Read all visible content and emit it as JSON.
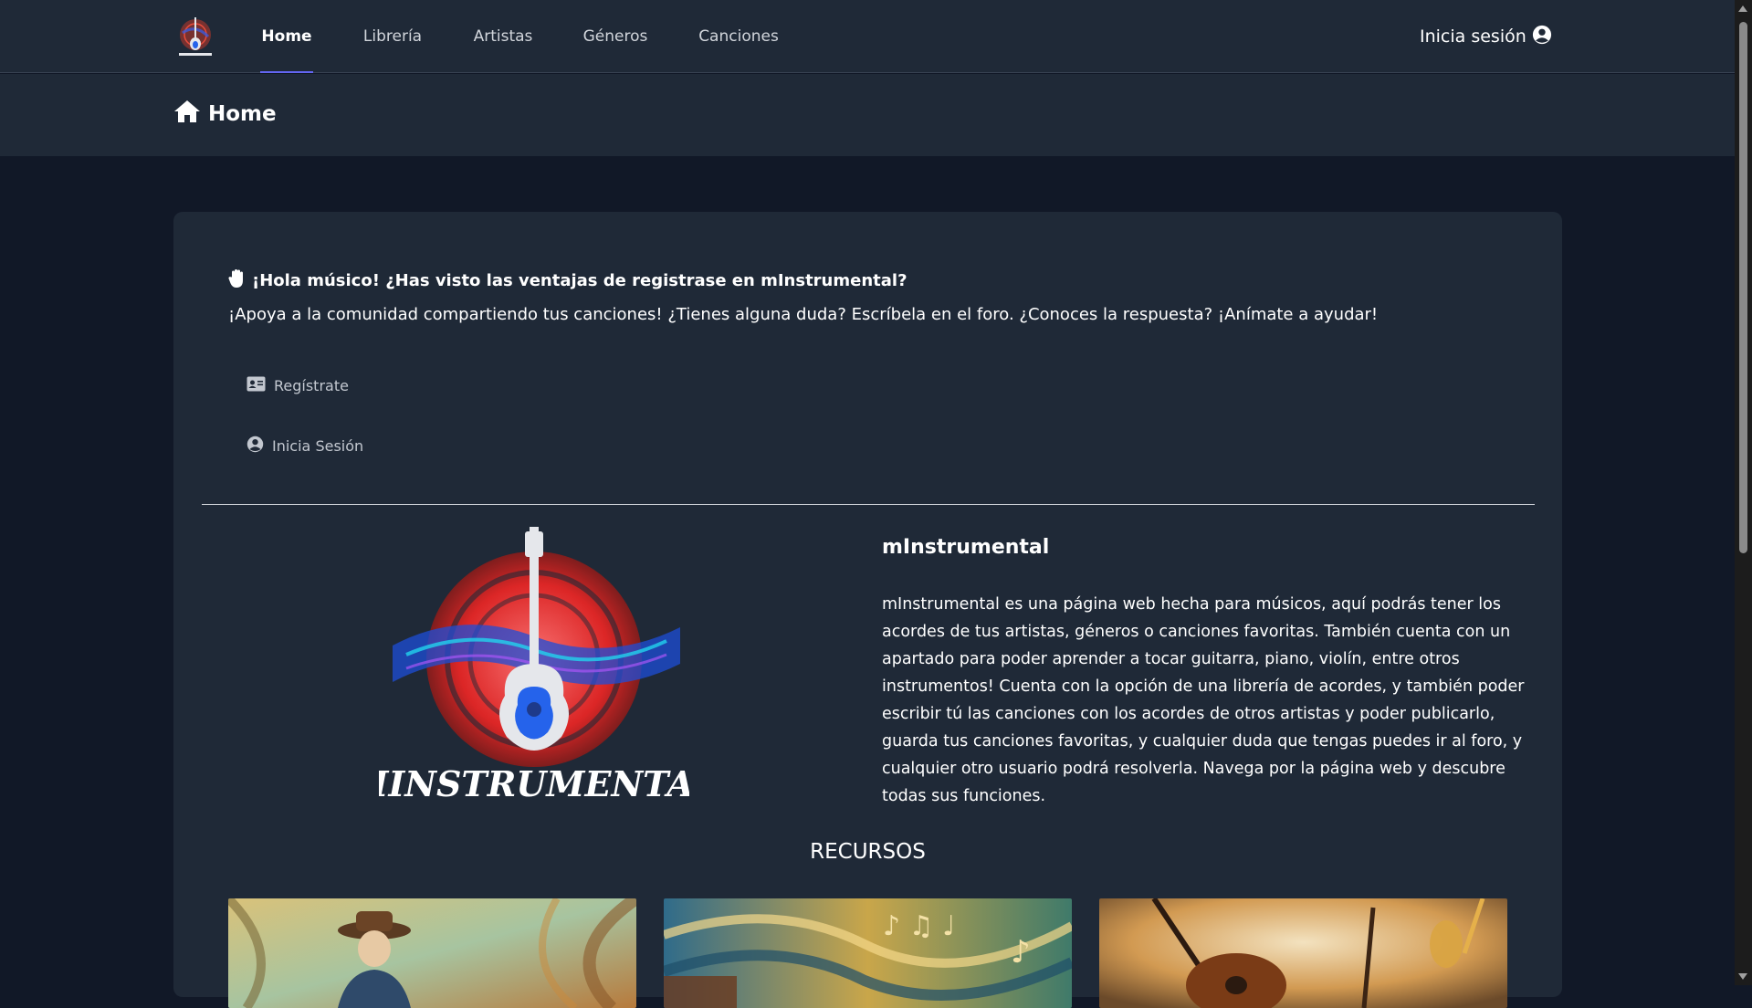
{
  "nav": {
    "links": [
      {
        "label": "Home",
        "active": true
      },
      {
        "label": "Librería",
        "active": false
      },
      {
        "label": "Artistas",
        "active": false
      },
      {
        "label": "Géneros",
        "active": false
      },
      {
        "label": "Canciones",
        "active": false
      }
    ],
    "login_label": "Inicia sesión",
    "login_icon": "user-circle-icon",
    "logo_text": "MINSTRUMENTAL"
  },
  "header": {
    "title": "Home",
    "icon": "home-icon"
  },
  "welcome": {
    "icon": "hand-icon",
    "heading": "¡Hola músico! ¿Has visto las ventajas de registrase en mInstrumental?",
    "subtext": "¡Apoya a la comunidad compartiendo tus canciones! ¿Tienes alguna duda? Escríbela en el foro. ¿Conoces la respuesta? ¡Anímate a ayudar!",
    "register_label": "Regístrate",
    "register_icon": "id-card-icon",
    "login_label": "Inicia Sesión",
    "login_icon": "user-circle-icon"
  },
  "about": {
    "logo_text": "MINSTRUMENTAL",
    "title": "mInstrumental",
    "description": "mInstrumental es una página web hecha para músicos, aquí podrás tener los acordes de tus artistas, géneros o canciones favoritas. También cuenta con un apartado para poder aprender a tocar guitarra, piano, violín, entre otros instrumentos! Cuenta con la opción de una librería de acordes, y también poder escribir tú las canciones con los acordes de otros artistas y poder publicarlo, guarda tus canciones favoritas, y cualquier duda que tengas puedes ir al foro, y cualquier otro usuario podrá resolverla. Navega por la página web y descubre todas sus funciones."
  },
  "resources": {
    "title": "RECURSOS"
  },
  "colors": {
    "page_bg": "#111827",
    "panel_bg": "#1f2937",
    "accent": "#6366f1"
  }
}
